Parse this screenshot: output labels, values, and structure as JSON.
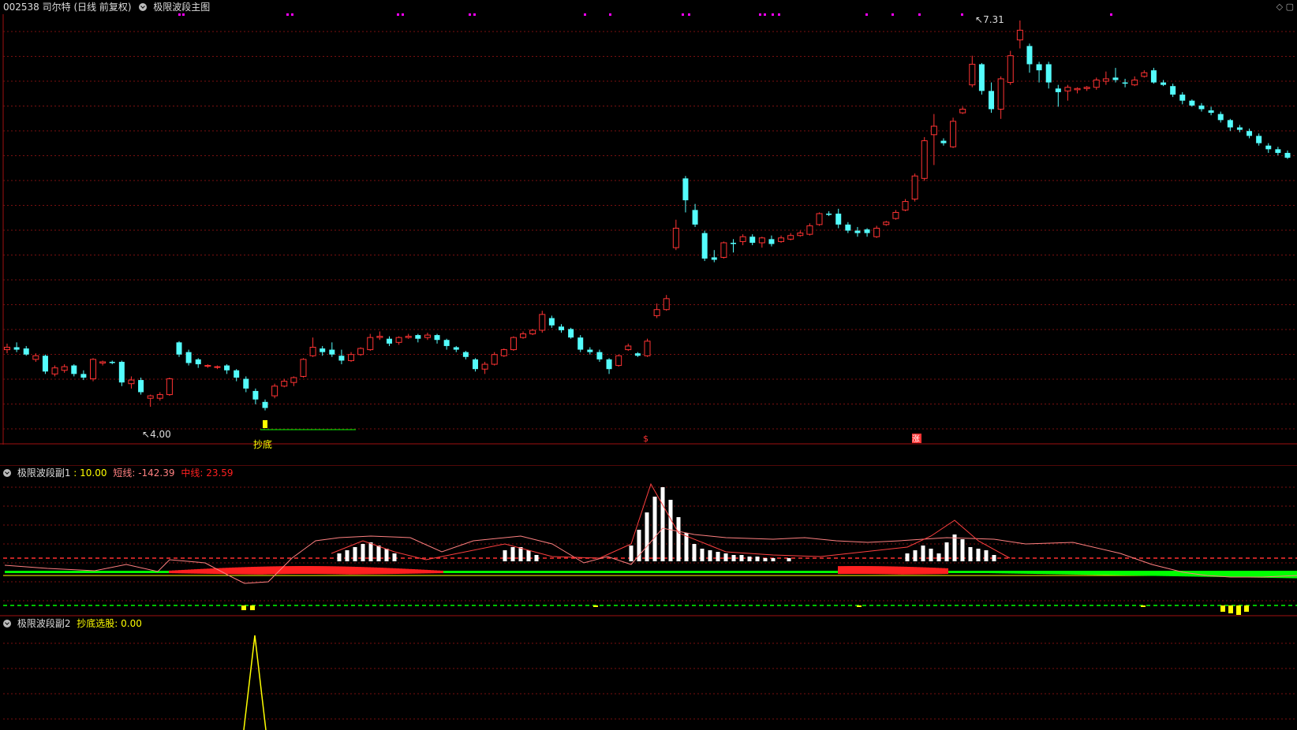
{
  "main_header": {
    "stock": "002538 司尔特 (日线 前复权)",
    "indicator": "极限波段主图"
  },
  "main_labels": {
    "high_value": "7.31",
    "low_value": "4.00",
    "buy_signal": "抄底",
    "marker1": "$",
    "marker2": "涨"
  },
  "sub1_header": {
    "name": "极限波段副1",
    "v0": ": 10.00",
    "short_label": "短线: -142.39",
    "mid_label": "中线: 23.59"
  },
  "sub2_header": {
    "name": "极限波段副2",
    "pick_label": "抄底选股: 0.00"
  },
  "colors": {
    "up": "#ff3333",
    "down": "#54fcfc",
    "grid": "#7a1010",
    "border": "#a01010",
    "yellow": "#ffff00",
    "green": "#00ff00",
    "magenta": "#ff00ff",
    "white": "#ffffff"
  },
  "chart_data": [
    {
      "type": "candlestick",
      "title": "极限波段主图",
      "y_high": 7.31,
      "y_low": 4.0,
      "candles": [
        [
          4.6,
          4.62,
          4.57,
          4.65
        ],
        [
          4.62,
          4.6,
          4.58,
          4.66
        ],
        [
          4.61,
          4.56,
          4.55,
          4.63
        ],
        [
          4.52,
          4.55,
          4.5,
          4.57
        ],
        [
          4.55,
          4.42,
          4.4,
          4.56
        ],
        [
          4.4,
          4.45,
          4.38,
          4.47
        ],
        [
          4.43,
          4.46,
          4.41,
          4.48
        ],
        [
          4.47,
          4.4,
          4.38,
          4.48
        ],
        [
          4.4,
          4.37,
          4.35,
          4.43
        ],
        [
          4.36,
          4.52,
          4.34,
          4.53
        ],
        [
          4.49,
          4.5,
          4.47,
          4.51
        ],
        [
          4.5,
          4.49,
          4.48,
          4.51
        ],
        [
          4.5,
          4.33,
          4.3,
          4.51
        ],
        [
          4.32,
          4.35,
          4.28,
          4.38
        ],
        [
          4.35,
          4.25,
          4.23,
          4.37
        ],
        [
          4.2,
          4.22,
          4.13,
          4.23
        ],
        [
          4.2,
          4.23,
          4.18,
          4.25
        ],
        [
          4.23,
          4.36,
          4.22,
          4.37
        ],
        [
          4.66,
          4.56,
          4.54,
          4.67
        ],
        [
          4.58,
          4.49,
          4.47,
          4.6
        ],
        [
          4.52,
          4.48,
          4.45,
          4.53
        ],
        [
          4.47,
          4.47,
          4.45,
          4.48
        ],
        [
          4.46,
          4.46,
          4.44,
          4.47
        ],
        [
          4.47,
          4.43,
          4.4,
          4.48
        ],
        [
          4.43,
          4.37,
          4.34,
          4.44
        ],
        [
          4.36,
          4.28,
          4.25,
          4.38
        ],
        [
          4.26,
          4.19,
          4.15,
          4.28
        ],
        [
          4.17,
          4.12,
          4.1,
          4.19
        ],
        [
          4.22,
          4.3,
          4.2,
          4.32
        ],
        [
          4.3,
          4.34,
          4.29,
          4.36
        ],
        [
          4.33,
          4.37,
          4.3,
          4.38
        ],
        [
          4.38,
          4.52,
          4.37,
          4.53
        ],
        [
          4.55,
          4.62,
          4.54,
          4.7
        ],
        [
          4.61,
          4.58,
          4.55,
          4.63
        ],
        [
          4.6,
          4.56,
          4.54,
          4.66
        ],
        [
          4.55,
          4.51,
          4.48,
          4.6
        ],
        [
          4.51,
          4.56,
          4.5,
          4.58
        ],
        [
          4.56,
          4.61,
          4.55,
          4.62
        ],
        [
          4.6,
          4.7,
          4.59,
          4.73
        ],
        [
          4.7,
          4.71,
          4.68,
          4.75
        ],
        [
          4.69,
          4.65,
          4.63,
          4.71
        ],
        [
          4.66,
          4.7,
          4.64,
          4.71
        ],
        [
          4.7,
          4.71,
          4.69,
          4.73
        ],
        [
          4.72,
          4.69,
          4.66,
          4.73
        ],
        [
          4.7,
          4.72,
          4.68,
          4.74
        ],
        [
          4.72,
          4.68,
          4.65,
          4.73
        ],
        [
          4.68,
          4.63,
          4.6,
          4.69
        ],
        [
          4.62,
          4.6,
          4.58,
          4.63
        ],
        [
          4.58,
          4.54,
          4.52,
          4.59
        ],
        [
          4.52,
          4.44,
          4.42,
          4.53
        ],
        [
          4.44,
          4.48,
          4.4,
          4.5
        ],
        [
          4.48,
          4.56,
          4.47,
          4.58
        ],
        [
          4.55,
          4.6,
          4.54,
          4.61
        ],
        [
          4.6,
          4.7,
          4.59,
          4.71
        ],
        [
          4.7,
          4.73,
          4.69,
          4.75
        ],
        [
          4.73,
          4.76,
          4.72,
          4.77
        ],
        [
          4.76,
          4.89,
          4.74,
          4.92
        ],
        [
          4.86,
          4.8,
          4.78,
          4.88
        ],
        [
          4.79,
          4.76,
          4.74,
          4.81
        ],
        [
          4.77,
          4.7,
          4.69,
          4.78
        ],
        [
          4.7,
          4.6,
          4.58,
          4.72
        ],
        [
          4.6,
          4.58,
          4.56,
          4.62
        ],
        [
          4.58,
          4.52,
          4.5,
          4.6
        ],
        [
          4.52,
          4.44,
          4.4,
          4.53
        ],
        [
          4.47,
          4.55,
          4.46,
          4.56
        ],
        [
          4.6,
          4.63,
          4.59,
          4.65
        ],
        [
          4.57,
          4.55,
          4.54,
          4.58
        ],
        [
          4.55,
          4.67,
          4.54,
          4.69
        ],
        [
          4.88,
          4.93,
          4.86,
          4.98
        ],
        [
          4.93,
          5.02,
          4.92,
          5.05
        ],
        [
          5.44,
          5.6,
          5.42,
          5.67
        ],
        [
          6.01,
          5.83,
          5.73,
          6.03
        ],
        [
          5.75,
          5.63,
          5.61,
          5.8
        ],
        [
          5.56,
          5.35,
          5.33,
          5.58
        ],
        [
          5.36,
          5.34,
          5.32,
          5.42
        ],
        [
          5.36,
          5.48,
          5.35,
          5.49
        ],
        [
          5.48,
          5.47,
          5.4,
          5.51
        ],
        [
          5.49,
          5.53,
          5.46,
          5.55
        ],
        [
          5.53,
          5.48,
          5.46,
          5.55
        ],
        [
          5.48,
          5.52,
          5.44,
          5.53
        ],
        [
          5.51,
          5.47,
          5.45,
          5.54
        ],
        [
          5.49,
          5.52,
          5.48,
          5.54
        ],
        [
          5.51,
          5.54,
          5.5,
          5.56
        ],
        [
          5.54,
          5.56,
          5.53,
          5.58
        ],
        [
          5.55,
          5.62,
          5.54,
          5.64
        ],
        [
          5.63,
          5.72,
          5.62,
          5.73
        ],
        [
          5.72,
          5.71,
          5.7,
          5.74
        ],
        [
          5.72,
          5.63,
          5.6,
          5.76
        ],
        [
          5.63,
          5.58,
          5.56,
          5.65
        ],
        [
          5.58,
          5.56,
          5.53,
          5.61
        ],
        [
          5.59,
          5.56,
          5.53,
          5.6
        ],
        [
          5.53,
          5.6,
          5.52,
          5.62
        ],
        [
          5.63,
          5.65,
          5.62,
          5.66
        ],
        [
          5.68,
          5.73,
          5.67,
          5.75
        ],
        [
          5.75,
          5.82,
          5.74,
          5.84
        ],
        [
          5.84,
          6.03,
          5.82,
          6.05
        ],
        [
          6.01,
          6.32,
          5.99,
          6.35
        ],
        [
          6.37,
          6.44,
          6.12,
          6.54
        ],
        [
          6.32,
          6.3,
          6.28,
          6.34
        ],
        [
          6.27,
          6.48,
          6.26,
          6.51
        ],
        [
          6.55,
          6.58,
          6.54,
          6.6
        ],
        [
          6.78,
          6.95,
          6.76,
          7.02
        ],
        [
          6.95,
          6.73,
          6.7,
          6.96
        ],
        [
          6.73,
          6.58,
          6.55,
          6.8
        ],
        [
          6.58,
          6.83,
          6.5,
          6.85
        ],
        [
          6.8,
          7.02,
          6.78,
          7.06
        ],
        [
          7.15,
          7.23,
          7.08,
          7.31
        ],
        [
          7.1,
          6.95,
          6.88,
          7.12
        ],
        [
          6.95,
          6.9,
          6.8,
          6.97
        ],
        [
          6.95,
          6.8,
          6.75,
          6.97
        ],
        [
          6.75,
          6.72,
          6.6,
          6.78
        ],
        [
          6.73,
          6.76,
          6.65,
          6.78
        ],
        [
          6.74,
          6.75,
          6.71,
          6.76
        ],
        [
          6.75,
          6.76,
          6.73,
          6.77
        ],
        [
          6.76,
          6.82,
          6.74,
          6.84
        ],
        [
          6.81,
          6.83,
          6.78,
          6.89
        ],
        [
          6.84,
          6.82,
          6.8,
          6.92
        ],
        [
          6.8,
          6.79,
          6.76,
          6.83
        ],
        [
          6.78,
          6.82,
          6.77,
          6.85
        ],
        [
          6.85,
          6.88,
          6.84,
          6.9
        ],
        [
          6.9,
          6.8,
          6.79,
          6.92
        ],
        [
          6.8,
          6.78,
          6.77,
          6.82
        ],
        [
          6.77,
          6.7,
          6.68,
          6.79
        ],
        [
          6.7,
          6.65,
          6.62,
          6.72
        ],
        [
          6.65,
          6.61,
          6.6,
          6.66
        ],
        [
          6.61,
          6.58,
          6.56,
          6.63
        ],
        [
          6.57,
          6.55,
          6.53,
          6.6
        ],
        [
          6.54,
          6.49,
          6.47,
          6.56
        ],
        [
          6.49,
          6.43,
          6.4,
          6.5
        ],
        [
          6.43,
          6.41,
          6.39,
          6.45
        ],
        [
          6.4,
          6.36,
          6.34,
          6.42
        ],
        [
          6.36,
          6.3,
          6.28,
          6.38
        ],
        [
          6.28,
          6.25,
          6.22,
          6.3
        ],
        [
          6.25,
          6.22,
          6.2,
          6.27
        ],
        [
          6.22,
          6.18,
          6.17,
          6.24
        ]
      ]
    },
    {
      "type": "bar",
      "title": "极限波段副1",
      "values": [
        10.0,
        -142.39,
        23.59
      ]
    },
    {
      "type": "line",
      "title": "极限波段副2",
      "values": [
        0.0
      ]
    }
  ]
}
